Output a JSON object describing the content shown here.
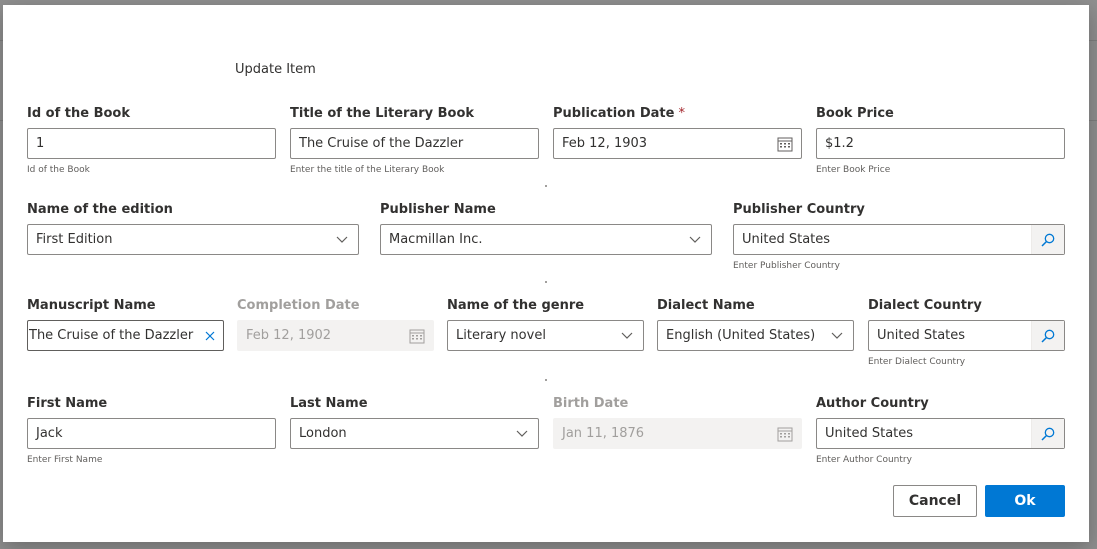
{
  "dialog": {
    "title": "Update Item",
    "cancel_label": "Cancel",
    "ok_label": "Ok"
  },
  "fields": {
    "book_id": {
      "label": "Id of the Book",
      "value": "1",
      "hint": "Id of the Book"
    },
    "book_title": {
      "label": "Title of the Literary Book",
      "value": "The Cruise of the Dazzler",
      "hint": "Enter the title of the Literary Book"
    },
    "publication_date": {
      "label": "Publication Date",
      "required_mark": "*",
      "value": "Feb 12, 1903",
      "icon": "calendar-icon"
    },
    "book_price": {
      "label": "Book Price",
      "value": "$1.2",
      "hint": "Enter Book Price"
    },
    "edition_name": {
      "label": "Name of the edition",
      "value": "First Edition",
      "icon": "chevron-down-icon"
    },
    "publisher_name": {
      "label": "Publisher Name",
      "value": "Macmillan Inc.",
      "icon": "chevron-down-icon"
    },
    "publisher_country": {
      "label": "Publisher Country",
      "value": "United States",
      "hint": "Enter Publisher Country",
      "icon": "search-icon"
    },
    "manuscript_name": {
      "label": "Manuscript Name",
      "value": "The Cruise of the Dazzler",
      "icon": "clear-icon"
    },
    "completion_date": {
      "label": "Completion Date",
      "value": "Feb 12, 1902",
      "icon": "calendar-icon",
      "disabled": true
    },
    "genre_name": {
      "label": "Name of the genre",
      "value": "Literary novel",
      "icon": "chevron-down-icon"
    },
    "dialect_name": {
      "label": "Dialect Name",
      "value": "English (United States)",
      "icon": "chevron-down-icon"
    },
    "dialect_country": {
      "label": "Dialect Country",
      "value": "United States",
      "hint": "Enter Dialect Country",
      "icon": "search-icon"
    },
    "first_name": {
      "label": "First Name",
      "value": "Jack",
      "hint": "Enter First Name"
    },
    "last_name": {
      "label": "Last Name",
      "value": "London",
      "icon": "chevron-down-icon"
    },
    "birth_date": {
      "label": "Birth Date",
      "value": "Jan 11, 1876",
      "icon": "calendar-icon",
      "disabled": true
    },
    "author_country": {
      "label": "Author Country",
      "value": "United States",
      "hint": "Enter Author Country",
      "icon": "search-icon"
    }
  },
  "colors": {
    "accent": "#0078d4",
    "required": "#a4262c",
    "disabled_bg": "#f3f2f1",
    "backdrop": "#8f8f8f"
  }
}
